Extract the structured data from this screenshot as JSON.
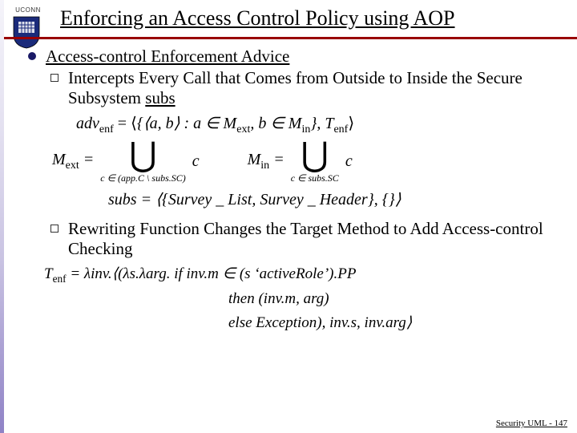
{
  "header": {
    "org": "UCONN",
    "title": "Enforcing an Access Control Policy using AOP"
  },
  "content": {
    "heading1": "Access-control Enforcement Advice",
    "bullet1": "Intercepts Every Call that Comes from Outside to Inside the Secure Subsystem ",
    "bullet1_subs": "subs",
    "bullet2": "Rewriting Function Changes the Target Method to Add Access-control Checking"
  },
  "formulas": {
    "advenf_lhs": "adv",
    "advenf_sub": "enf",
    "eq": " = ",
    "langle": "⟨",
    "rangle": "⟩",
    "set_open": "{⟨a, b⟩ : a ∈ M",
    "mext_sub": "ext",
    "set_mid": ", b ∈ M",
    "min_sub": "in",
    "set_close": "}",
    "comma": ", ",
    "T": "T",
    "mext_label": "M",
    "min_label": "M",
    "union_c": "c",
    "sub1_pre": "c ∈ (app.C \\ subs.SC)",
    "sub2_pre": "c ∈ subs.SC",
    "subs_lhs": "subs",
    "subs_eq": " = ⟨{",
    "subs_item1": "Survey _ List",
    "subs_sep": ", ",
    "subs_item2": "Survey _ Header",
    "subs_close": "}, {}⟩",
    "tenf_lhs": "T",
    "lambda_inv": " = λinv.⟨(λs.λarg. ",
    "if_kw": "if",
    "inv_m": " inv.m ∈ (s ‘activeRole’).PP",
    "then_kw": "then",
    "then_body": " (inv.m, arg)",
    "else_kw": "else",
    "else_body": " Exception",
    "tail": "), inv.s, inv.arg⟩"
  },
  "footer": {
    "text": "Security UML - 147"
  }
}
